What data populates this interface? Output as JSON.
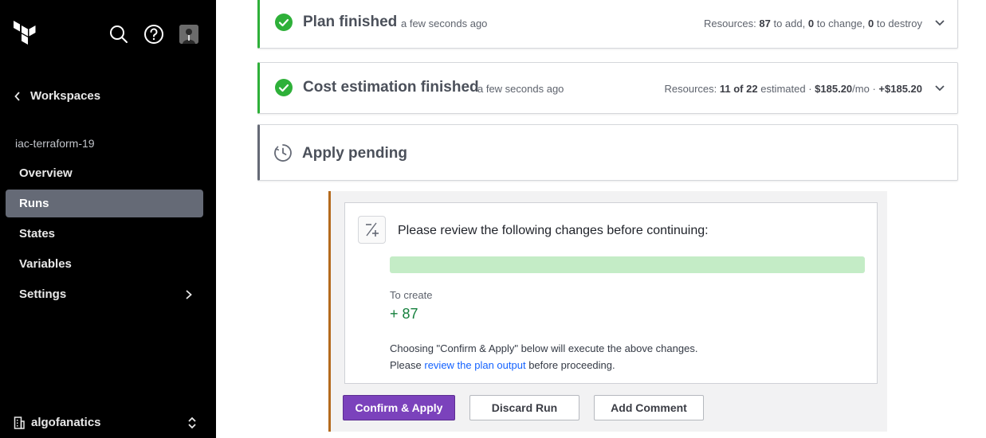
{
  "sidebar": {
    "logo_icon": "terraform-logo",
    "search_icon": "search-icon",
    "help_icon": "help-icon",
    "back_label": "Workspaces",
    "workspace_name": "iac-terraform-19",
    "nav_items": [
      {
        "label": "Overview",
        "active": false
      },
      {
        "label": "Runs",
        "active": true
      },
      {
        "label": "States",
        "active": false
      },
      {
        "label": "Variables",
        "active": false
      },
      {
        "label": "Settings",
        "active": false,
        "has_submenu": true
      }
    ],
    "org_name": "algofanatics"
  },
  "plan": {
    "title": "Plan finished",
    "time": "a few seconds ago",
    "summary_prefix": "Resources:",
    "add": "87",
    "add_suffix": "to add,",
    "change": "0",
    "change_suffix": "to change,",
    "destroy": "0",
    "destroy_suffix": "to destroy"
  },
  "cost": {
    "title": "Cost estimation finished",
    "time": "a few seconds ago",
    "summary_prefix": "Resources:",
    "estimated_count": "11 of 22",
    "estimated_suffix": "estimated ·",
    "monthly": "$185.20",
    "monthly_suffix": "/mo ·",
    "delta": "+$185.20"
  },
  "apply": {
    "title": "Apply pending"
  },
  "review": {
    "heading": "Please review the following changes before continuing:",
    "progress_fraction": 1.0,
    "create_label": "To create",
    "create_count": "+ 87",
    "note_line1": "Choosing \"Confirm & Apply\" below will execute the above changes.",
    "note_line2_prefix": "Please",
    "note_link": "review the plan output",
    "note_line2_suffix": "before proceeding."
  },
  "actions": {
    "confirm_label": "Confirm & Apply",
    "discard_label": "Discard Run",
    "comment_label": "Add Comment"
  },
  "colors": {
    "sidebar_bg": "#000000",
    "success": "#2eb039",
    "primary_button": "#7b42bc",
    "pending_accent": "#b46a1d",
    "link": "#1563ff"
  }
}
